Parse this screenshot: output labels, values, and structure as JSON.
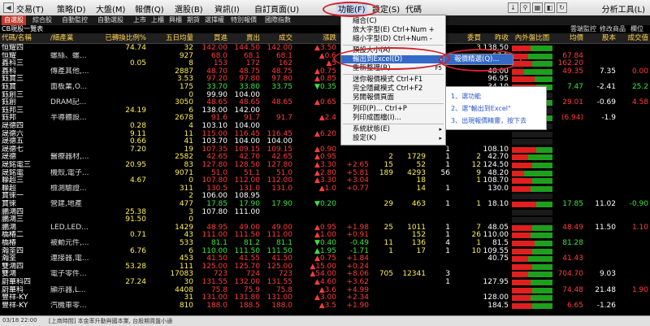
{
  "menubar": {
    "items": [
      "交易(T)",
      "策略(D)",
      "大盤(M)",
      "報價(Q)",
      "選股(B)",
      "資訊(I)",
      "自訂頁面(U)",
      "功能(F)",
      "設定(S)",
      "代碼"
    ],
    "right_label": "分析工具(L)"
  },
  "tabs": [
    "自選股",
    "綜合股",
    "自動監控",
    "自動選股",
    "上市",
    "上櫃",
    "興櫃",
    "期貨",
    "選擇權",
    "特別報價",
    "國際指數"
  ],
  "list_title": "CB現股一覽表",
  "right_labels": [
    "雲端監控",
    "修改商品",
    "欄位"
  ],
  "columns": [
    "代碼/名稱",
    "/細產業",
    "已轉換比例%",
    "五日均量",
    "買進",
    "賣出",
    "成交",
    "漲跌",
    "",
    "",
    "",
    "",
    "委買",
    "昨收",
    "內外盤比圖",
    "均價",
    "股本",
    "成交值"
  ],
  "rows": [
    {
      "name": "恒耀四",
      "ind": "",
      "cv": "74.74",
      "avg": "32",
      "bid": "142.00",
      "ask": "144.50",
      "last": "142.00",
      "chg": "▲3.50",
      "vol": "",
      "v1": "",
      "v2": "",
      "v3": "",
      "buy": "3",
      "prev": "138.50",
      "ratio": [
        0.45,
        0.55
      ],
      "avgp": "",
      "cap": "",
      "amt": "",
      "c": "up"
    },
    {
      "name": "恒耀",
      "ind": "螺絲、螺...",
      "cv": "",
      "avg": "927",
      "bid": "68.0",
      "ask": "68.1",
      "last": "68.1",
      "chg": "▲0.6",
      "vol": "",
      "v1": "",
      "v2": "",
      "v3": "",
      "buy": "",
      "prev": "67.5",
      "ratio": [
        0.4,
        0.6
      ],
      "avgp": "67.84",
      "cap": "",
      "amt": "",
      "c": "up"
    },
    {
      "name": "鑫科三",
      "ind": "",
      "cv": "0.05",
      "avg": "8",
      "bid": "153",
      "ask": "172",
      "last": "162",
      "chg": "▲5",
      "vol": "",
      "v1": "",
      "v2": "",
      "v3": "",
      "buy": "",
      "prev": "157",
      "ratio": [
        0.5,
        0.5
      ],
      "avgp": "162.20",
      "cap": "",
      "amt": "",
      "c": "up"
    },
    {
      "name": "鑫科",
      "ind": "傳產其他,...",
      "cv": "",
      "avg": "2887",
      "bid": "48.70",
      "ask": "48.75",
      "last": "48.75",
      "chg": "▲0.75",
      "vol": "",
      "v1": "",
      "v2": "",
      "v3": "",
      "buy": "",
      "prev": "48.00",
      "ratio": [
        0.3,
        0.7
      ],
      "avgp": "49.35",
      "cap": "7.35",
      "amt": "0.00",
      "c": "up"
    },
    {
      "name": "鈺寶三",
      "ind": "",
      "cv": "",
      "avg": "3.53",
      "bid": "97.20",
      "ask": "97.80",
      "last": "97.80",
      "chg": "▲0.85",
      "vol": "",
      "v1": "",
      "v2": "",
      "v3": "",
      "buy": "",
      "prev": "96.95",
      "ratio": [
        0.55,
        0.45
      ],
      "avgp": "",
      "cap": "",
      "amt": "",
      "c": "up"
    },
    {
      "name": "鈺寶",
      "ind": "面板業,O...",
      "cv": "",
      "avg": "175",
      "bid": "33.70",
      "ask": "33.80",
      "last": "33.75",
      "chg": "▼0.35",
      "vol": "",
      "v1": "",
      "v2": "",
      "v3": "",
      "buy": "",
      "prev": "34.10",
      "ratio": [
        0.6,
        0.4
      ],
      "avgp": "7.47",
      "cap": "-2.41",
      "amt": "25.2",
      "c": "dn"
    },
    {
      "name": "鈺創三",
      "ind": "",
      "cv": "",
      "avg": "0",
      "bid": "99.90",
      "ask": "104.00",
      "last": "",
      "chg": "",
      "vol": "",
      "v1": "",
      "v2": "",
      "v3": "",
      "buy": "",
      "prev": "",
      "ratio": [
        0,
        0
      ],
      "avgp": "",
      "cap": "",
      "amt": "",
      "c": "fl"
    },
    {
      "name": "鈺創",
      "ind": "DRAM記...",
      "cv": "",
      "avg": "3050",
      "bid": "48.65",
      "ask": "48.65",
      "last": "48.65",
      "chg": "▲0.65",
      "vol": "",
      "v1": "",
      "v2": "",
      "v3": "",
      "buy": "",
      "prev": "48.00",
      "ratio": [
        0.5,
        0.5
      ],
      "avgp": "29.01",
      "cap": "-0.69",
      "amt": "4.58",
      "c": "up"
    },
    {
      "name": "鈺邦三",
      "ind": "",
      "cv": "24.19",
      "avg": "6",
      "bid": "138.00",
      "ask": "142.00",
      "last": "",
      "chg": "",
      "vol": "",
      "v1": "",
      "v2": "",
      "v3": "",
      "buy": "",
      "prev": "",
      "ratio": [
        0,
        0
      ],
      "avgp": "",
      "cap": "",
      "amt": "",
      "c": "fl"
    },
    {
      "name": "鈺邦",
      "ind": "半導體設...",
      "cv": "",
      "avg": "2678",
      "bid": "91.6",
      "ask": "91.7",
      "last": "91.7",
      "chg": "▲2.4",
      "vol": "",
      "v1": "",
      "v2": "",
      "v3": "",
      "buy": "",
      "prev": "89.3",
      "ratio": [
        0.45,
        0.55
      ],
      "avgp": "(6.94)",
      "cap": "-1.9",
      "amt": "",
      "c": "up"
    },
    {
      "name": "晟德四",
      "ind": "",
      "cv": "0.28",
      "avg": "4",
      "bid": "103.10",
      "ask": "104.00",
      "last": "",
      "chg": "",
      "vol": "",
      "v1": "",
      "v2": "",
      "v3": "",
      "buy": "",
      "prev": "",
      "ratio": [
        0,
        0
      ],
      "avgp": "",
      "cap": "",
      "amt": "",
      "c": "fl"
    },
    {
      "name": "晟德六",
      "ind": "",
      "cv": "9.11",
      "avg": "11",
      "bid": "115.00",
      "ask": "116.45",
      "last": "116.45",
      "chg": "▲6.20",
      "vol": "",
      "v1": "",
      "v2": "",
      "v3": "",
      "buy": "",
      "prev": "",
      "ratio": [
        0,
        0
      ],
      "avgp": "",
      "cap": "",
      "amt": "",
      "c": "up"
    },
    {
      "name": "晟德五",
      "ind": "",
      "cv": "0.66",
      "avg": "41",
      "bid": "103.70",
      "ask": "104.00",
      "last": "104.00",
      "chg": "",
      "vol": "",
      "v1": "",
      "v2": "",
      "v3": "",
      "buy": "",
      "prev": "",
      "ratio": [
        0,
        0
      ],
      "avgp": "",
      "cap": "",
      "amt": "",
      "c": "fl"
    },
    {
      "name": "晟德七",
      "ind": "",
      "cv": "7.20",
      "avg": "19",
      "bid": "107.35",
      "ask": "109.15",
      "last": "109.15",
      "chg": "▲0.90",
      "vol": "",
      "v1": "",
      "v2": "",
      "v3": "1",
      "buy": "",
      "prev": "108.10",
      "ratio": [
        0.6,
        0.4
      ],
      "avgp": "",
      "cap": "",
      "amt": "",
      "c": "up"
    },
    {
      "name": "晟德",
      "ind": "醫療器材,...",
      "cv": "",
      "avg": "2582",
      "bid": "42.65",
      "ask": "42.70",
      "last": "42.65",
      "chg": "▲0.95",
      "vol": "",
      "v1": "2",
      "v2": "1729",
      "v3": "1",
      "buy": "2",
      "prev": "42.70",
      "ratio": [
        0.4,
        0.6
      ],
      "avgp": "",
      "cap": "",
      "amt": "",
      "c": "up"
    },
    {
      "name": "晟銘電三",
      "ind": "",
      "cv": "20.95",
      "avg": "83",
      "bid": "127.80",
      "ask": "128.50",
      "last": "127.80",
      "chg": "▲3.30",
      "vol": "+2.65",
      "v1": "15",
      "v2": "52",
      "v3": "1",
      "buy": "12",
      "prev": "124.50",
      "ratio": [
        0.5,
        0.5
      ],
      "avgp": "",
      "cap": "",
      "amt": "",
      "c": "up"
    },
    {
      "name": "晟銘電",
      "ind": "機殼,電子...",
      "cv": "",
      "avg": "9071",
      "bid": "51.0",
      "ask": "51.1",
      "last": "51.0",
      "chg": "▲2.80",
      "vol": "+5.81",
      "v1": "189",
      "v2": "4293",
      "v3": "56",
      "buy": "9",
      "prev": "48.20",
      "ratio": [
        0.3,
        0.7
      ],
      "avgp": "",
      "cap": "",
      "amt": "",
      "c": "up"
    },
    {
      "name": "聯超三",
      "ind": "",
      "cv": "4.67",
      "avg": "0",
      "bid": "107.80",
      "ask": "112.00",
      "last": "112.00",
      "chg": "▲3.30",
      "vol": "+3.04",
      "v1": "",
      "v2": "18",
      "v3": "",
      "buy": "1",
      "prev": "108.70",
      "ratio": [
        0.5,
        0.5
      ],
      "avgp": "",
      "cap": "",
      "amt": "",
      "c": "up"
    },
    {
      "name": "聯超",
      "ind": "檢測驗證...",
      "cv": "",
      "avg": "311",
      "bid": "130.5",
      "ask": "131.0",
      "last": "131.0",
      "chg": "▲1.0",
      "vol": "+0.77",
      "v1": "",
      "v2": "14",
      "v3": "1",
      "buy": "",
      "prev": "130.0",
      "ratio": [
        0.45,
        0.55
      ],
      "avgp": "",
      "cap": "",
      "amt": "",
      "c": "up"
    },
    {
      "name": "寶徠一",
      "ind": "",
      "cv": "",
      "avg": "2",
      "bid": "106.00",
      "ask": "108.95",
      "last": "",
      "chg": "",
      "vol": "",
      "v1": "",
      "v2": "",
      "v3": "",
      "buy": "",
      "prev": "",
      "ratio": [
        0,
        0
      ],
      "avgp": "",
      "cap": "",
      "amt": "",
      "c": "fl"
    },
    {
      "name": "寶徠",
      "ind": "營建,地產",
      "cv": "",
      "avg": "477",
      "bid": "17.85",
      "ask": "17.90",
      "last": "17.90",
      "chg": "▼0.20",
      "vol": "",
      "v1": "29",
      "v2": "463",
      "v3": "1",
      "buy": "1",
      "prev": "18.10",
      "ratio": [
        0.6,
        0.4
      ],
      "avgp": "17.85",
      "cap": "11.02",
      "amt": "-0.90",
      "c": "dn"
    },
    {
      "name": "鵬鴻四",
      "ind": "",
      "cv": "25.38",
      "avg": "3",
      "bid": "107.80",
      "ask": "111.00",
      "last": "",
      "chg": "",
      "vol": "",
      "v1": "",
      "v2": "",
      "v3": "",
      "buy": "",
      "prev": "",
      "ratio": [
        0,
        0
      ],
      "avgp": "",
      "cap": "",
      "amt": "",
      "c": "fl"
    },
    {
      "name": "鵬鴻三",
      "ind": "",
      "cv": "91.50",
      "avg": "0",
      "bid": "",
      "ask": "",
      "last": "",
      "chg": "",
      "vol": "",
      "v1": "",
      "v2": "",
      "v3": "",
      "buy": "",
      "prev": "",
      "ratio": [
        0,
        0
      ],
      "avgp": "",
      "cap": "",
      "amt": "",
      "c": "fl"
    },
    {
      "name": "鵬鴻",
      "ind": "LED,LED...",
      "cv": "",
      "avg": "1429",
      "bid": "48.95",
      "ask": "49.00",
      "last": "49.00",
      "chg": "▲0.95",
      "vol": "+1.98",
      "v1": "25",
      "v2": "1011",
      "v3": "1",
      "buy": "7",
      "prev": "48.05",
      "ratio": [
        0.5,
        0.5
      ],
      "avgp": "48.49",
      "cap": "11.50",
      "amt": "1.10",
      "c": "up"
    },
    {
      "name": "橋椿二",
      "ind": "",
      "cv": "0.71",
      "avg": "43",
      "bid": "111.00",
      "ask": "111.50",
      "last": "111.00",
      "chg": "▲1.00",
      "vol": "+0.91",
      "v1": "",
      "v2": "152",
      "v3": "1",
      "buy": "26",
      "prev": "110.00",
      "ratio": [
        0.45,
        0.55
      ],
      "avgp": "",
      "cap": "",
      "amt": "",
      "c": "up"
    },
    {
      "name": "橋椿",
      "ind": "被動元件,...",
      "cv": "",
      "avg": "533",
      "bid": "81.1",
      "ask": "81.2",
      "last": "81.1",
      "chg": "▼0.40",
      "vol": "-0.49",
      "v1": "11",
      "v2": "136",
      "v3": "4",
      "buy": "1",
      "prev": "81.5",
      "ratio": [
        0.55,
        0.45
      ],
      "avgp": "81.28",
      "cap": "",
      "amt": "",
      "c": "dn"
    },
    {
      "name": "瀚荃四",
      "ind": "",
      "cv": "6.76",
      "avg": "6",
      "bid": "110.00",
      "ask": "111.50",
      "last": "111.50",
      "chg": "▲1.95",
      "vol": "-1.71",
      "v1": "1",
      "v2": "17",
      "v3": "1",
      "buy": "10",
      "prev": "109.55",
      "ratio": [
        0.5,
        0.5
      ],
      "avgp": "",
      "cap": "",
      "amt": "",
      "c": "dn"
    },
    {
      "name": "瀚荃",
      "ind": "連接器,電...",
      "cv": "",
      "avg": "453",
      "bid": "41.50",
      "ask": "41.55",
      "last": "41.50",
      "chg": "▲0.75",
      "vol": "+1.84",
      "v1": "",
      "v2": "",
      "v3": "",
      "buy": "",
      "prev": "40.75",
      "ratio": [
        0.4,
        0.6
      ],
      "avgp": "41.43",
      "cap": "",
      "amt": "",
      "c": "up"
    },
    {
      "name": "雙鴻四",
      "ind": "",
      "cv": "53.28",
      "avg": "111",
      "bid": "125.00",
      "ask": "125.70",
      "last": "125.00",
      "chg": "▲15.00",
      "vol": "+0.24",
      "v1": "",
      "v2": "",
      "v3": "",
      "buy": "",
      "prev": "",
      "ratio": [
        0.5,
        0.5
      ],
      "avgp": "",
      "cap": "",
      "amt": "",
      "c": "up"
    },
    {
      "name": "雙鴻",
      "ind": "電子零件...",
      "cv": "",
      "avg": "17083",
      "bid": "723",
      "ask": "724",
      "last": "723",
      "chg": "▲54.00",
      "vol": "+8.06",
      "v1": "705",
      "v2": "12341",
      "v3": "3",
      "buy": "",
      "prev": "",
      "ratio": [
        0.4,
        0.6
      ],
      "avgp": "704.70",
      "cap": "9.03",
      "amt": "",
      "c": "up"
    },
    {
      "name": "蔚華科四",
      "ind": "",
      "cv": "27.24",
      "avg": "30",
      "bid": "131.55",
      "ask": "132.00",
      "last": "131.55",
      "chg": "▲4.60",
      "vol": "+3.62",
      "v1": "",
      "v2": "",
      "v3": "1",
      "buy": "",
      "prev": "127.95",
      "ratio": [
        0.45,
        0.55
      ],
      "avgp": "",
      "cap": "",
      "amt": "",
      "c": "up"
    },
    {
      "name": "蔚華科",
      "ind": "顯示器,L...",
      "cv": "",
      "avg": "4408",
      "bid": "75.8",
      "ask": "75.9",
      "last": "75.8",
      "chg": "▲3.6",
      "vol": "+4.99",
      "v1": "",
      "v2": "",
      "v3": "",
      "buy": "",
      "prev": "",
      "ratio": [
        0.5,
        0.5
      ],
      "avgp": "74.48",
      "cap": "21.48",
      "amt": "1.90",
      "c": "up"
    },
    {
      "name": "豐祥-KY",
      "ind": "",
      "cv": "",
      "avg": "31",
      "bid": "131.00",
      "ask": "131.80",
      "last": "131.00",
      "chg": "▲3.00",
      "vol": "+2.34",
      "v1": "",
      "v2": "",
      "v3": "",
      "buy": "",
      "prev": "128.00",
      "ratio": [
        0.45,
        0.55
      ],
      "avgp": "",
      "cap": "",
      "amt": "",
      "c": "up"
    },
    {
      "name": "豐祥-KY",
      "ind": "汽機車零...",
      "cv": "",
      "avg": "810",
      "bid": "188.0",
      "ask": "188.5",
      "last": "188.0",
      "chg": "▲3.5",
      "vol": "+1.90",
      "v1": "",
      "v2": "",
      "v3": "",
      "buy": "",
      "prev": "184.5",
      "ratio": [
        0.5,
        0.5
      ],
      "avgp": "6.65",
      "cap": "-1.26",
      "amt": "",
      "c": "up"
    }
  ],
  "menu": {
    "items": [
      {
        "label": "縮合(C)",
        "arrow": ""
      },
      {
        "label": "放大字型(E) Ctrl+Num +",
        "arrow": ""
      },
      {
        "label": "縮小字型(D) Ctrl+Num -",
        "arrow": ""
      },
      {
        "label": "預設大小(A)",
        "arrow": ""
      },
      {
        "label": "輸出到Excel(D)",
        "arrow": "▸",
        "selected": true
      },
      {
        "label": "重新整理(R)",
        "arrow": "F5"
      },
      {
        "label": "迷你報價模式 Ctrl+F1",
        "arrow": ""
      },
      {
        "label": "完全隱藏模式 Ctrl+F2",
        "arrow": ""
      },
      {
        "label": "另開報價頁面",
        "arrow": ""
      },
      {
        "label": "列印(P)... Ctrl+P",
        "arrow": ""
      },
      {
        "label": "列印成圖檔(I)...",
        "arrow": ""
      },
      {
        "label": "系統狀態(E)",
        "arrow": "▸"
      },
      {
        "label": "設定(K)",
        "arrow": "▸"
      }
    ],
    "submenu": "報價精選(Q)..."
  },
  "note": [
    "1、選功能",
    "2、選\"輸出到Excel\"",
    "3、出現報價精靈，按下去"
  ],
  "status": [
    "03/18 22:00",
    "[上商時間] 本金率升動與國本業, 台股期貨盤小通"
  ],
  "colors": {
    "up": "#ff3b3b",
    "down": "#3ee53e",
    "accent": "#d0202a",
    "menu_select": "#3469c8"
  }
}
